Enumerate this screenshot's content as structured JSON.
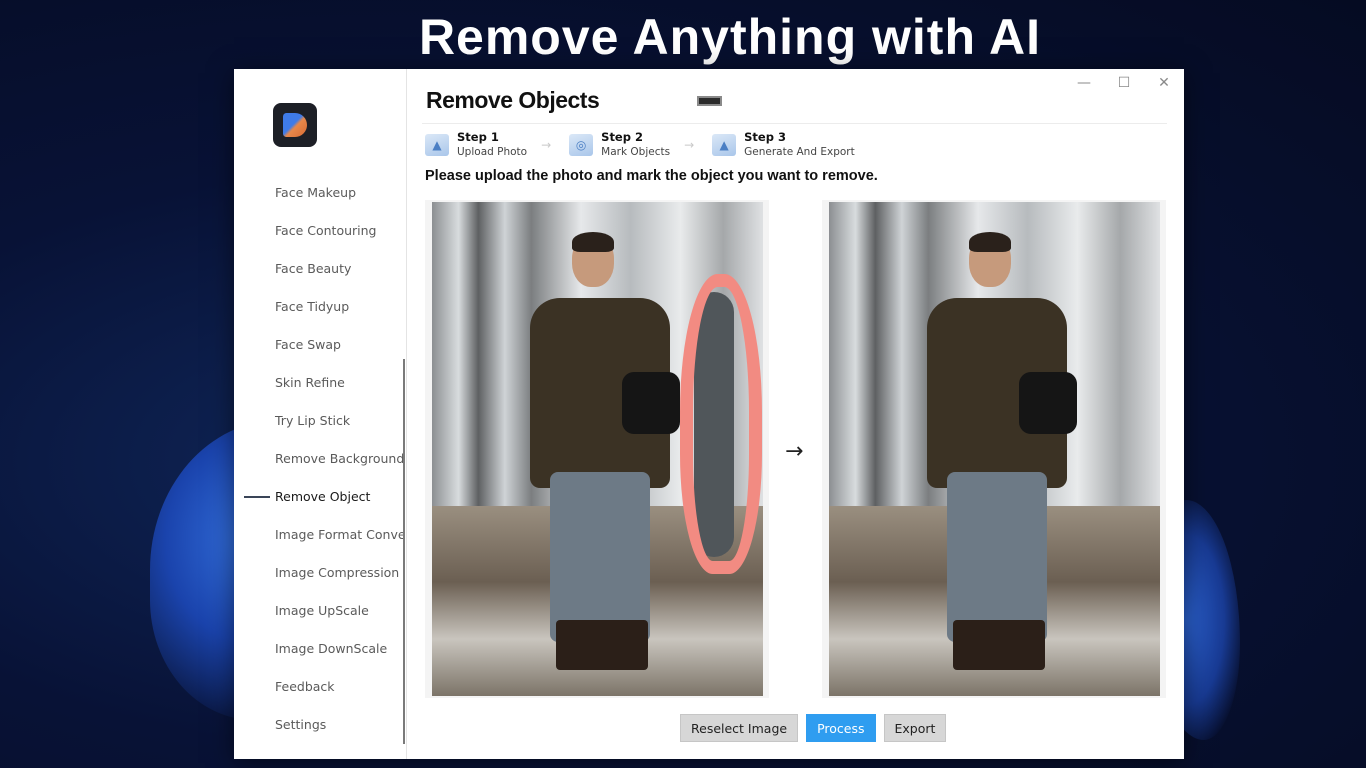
{
  "banner": {
    "title": "Remove Anything with AI"
  },
  "window": {
    "controls": {
      "minimize": "—",
      "maximize": "☐",
      "close": "✕"
    }
  },
  "sidebar": {
    "items": [
      {
        "label": "Face Makeup",
        "active": false
      },
      {
        "label": "Face Contouring",
        "active": false
      },
      {
        "label": "Face Beauty",
        "active": false
      },
      {
        "label": "Face Tidyup",
        "active": false
      },
      {
        "label": "Face Swap",
        "active": false
      },
      {
        "label": "Skin Refine",
        "active": false
      },
      {
        "label": "Try Lip Stick",
        "active": false
      },
      {
        "label": "Remove Background",
        "active": false
      },
      {
        "label": "Remove Object",
        "active": true
      },
      {
        "label": "Image Format Conve",
        "active": false
      },
      {
        "label": "Image Compression",
        "active": false
      },
      {
        "label": "Image UpScale",
        "active": false
      },
      {
        "label": "Image DownScale",
        "active": false
      },
      {
        "label": "Feedback",
        "active": false
      },
      {
        "label": "Settings",
        "active": false
      }
    ]
  },
  "main": {
    "title": "Remove Objects",
    "steps": [
      {
        "num": "Step 1",
        "desc": "Upload Photo",
        "icon": "upload-photo-icon"
      },
      {
        "num": "Step 2",
        "desc": "Mark Objects",
        "icon": "mark-objects-icon"
      },
      {
        "num": "Step 3",
        "desc": "Generate And Export",
        "icon": "generate-export-icon"
      }
    ],
    "step_arrow": "→",
    "instruction": "Please upload the photo and mark the object you want to remove.",
    "process_arrow": "→",
    "mask_color": "#f28b82",
    "buttons": {
      "reselect": "Reselect Image",
      "process": "Process",
      "export": "Export"
    },
    "accent": "#2f9df0"
  }
}
